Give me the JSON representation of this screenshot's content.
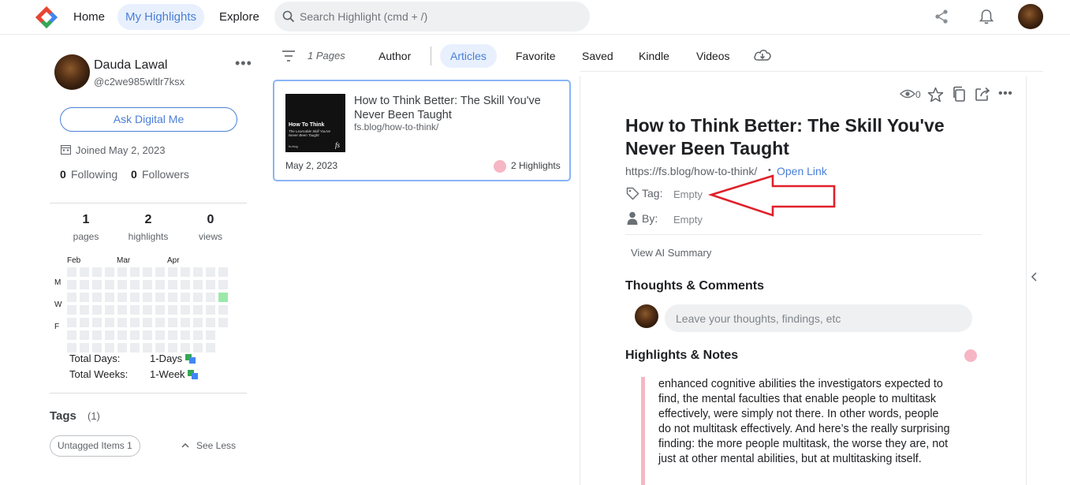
{
  "nav": {
    "home": "Home",
    "my_highlights": "My Highlights",
    "explore": "Explore",
    "search_placeholder": "Search Highlight (cmd + /)"
  },
  "profile": {
    "name": "Dauda Lawal",
    "handle": "@c2we985wltlr7ksx",
    "ask_button": "Ask Digital Me",
    "joined": "Joined May 2, 2023",
    "following_count": "0",
    "following_label": "Following",
    "followers_count": "0",
    "followers_label": "Followers",
    "stats": [
      {
        "value": "1",
        "label": "pages"
      },
      {
        "value": "2",
        "label": "highlights"
      },
      {
        "value": "0",
        "label": "views"
      }
    ]
  },
  "heatmap": {
    "months": [
      "Feb",
      "Mar",
      "Apr"
    ],
    "days": [
      "M",
      "W",
      "F"
    ],
    "total_days_label": "Total Days:",
    "total_days_value": "1-Days",
    "total_weeks_label": "Total Weeks:",
    "total_weeks_value": "1-Week",
    "active_color": "#9be9a8",
    "empty_color": "#ebedf0"
  },
  "tags": {
    "title": "Tags",
    "count": "(1)",
    "untagged": "Untagged Items 1",
    "see_less": "See Less"
  },
  "filters": {
    "pages": "1 Pages",
    "tabs": [
      "Author",
      "Articles",
      "Favorite",
      "Saved",
      "Kindle",
      "Videos"
    ],
    "active_tab": "Articles"
  },
  "card": {
    "thumb_title": "How To Think",
    "thumb_subtitle": "The Learnable Skill You've Never Been Taught",
    "thumb_brand": "fs",
    "thumb_footer": "fs.blog",
    "title": "How to Think Better: The Skill You've Never Been Taught",
    "url": "fs.blog/how-to-think/",
    "date": "May 2, 2023",
    "highlights": "2 Highlights"
  },
  "detail": {
    "views": "0",
    "title": "How to Think Better: The Skill You've Never Been Taught",
    "url": "https://fs.blog/how-to-think/",
    "separator": "•",
    "open_link": "Open Link",
    "tag_label": "Tag:",
    "tag_value": "Empty",
    "by_label": "By:",
    "by_value": "Empty",
    "ai_summary": "View AI Summary",
    "thoughts_title": "Thoughts & Comments",
    "comment_placeholder": "Leave your thoughts, findings, etc",
    "highlights_title": "Highlights & Notes",
    "highlight_color": "#f7b6c3",
    "quote": "enhanced cognitive abilities the investigators expected to find, the mental faculties that enable people to multitask effectively, were simply not there. In other words, people do not multitask effectively. And here’s the really surprising finding: the more people multitask, the worse they are, not just at other mental abilities, but at multitasking itself."
  },
  "colors": {
    "accent": "#4a7fd6",
    "annotation_arrow": "#e0202a"
  }
}
